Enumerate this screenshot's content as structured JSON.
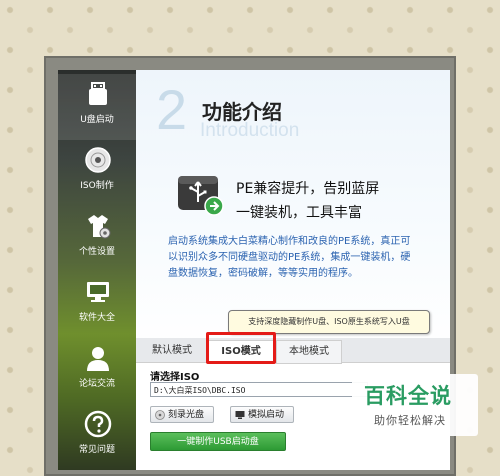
{
  "sidebar": {
    "items": [
      {
        "label": "U盘启动",
        "icon": "usb-drive-icon",
        "active": true
      },
      {
        "label": "ISO制作",
        "icon": "disc-icon",
        "active": false
      },
      {
        "label": "个性设置",
        "icon": "shirt-gear-icon",
        "active": false
      },
      {
        "label": "软件大全",
        "icon": "monitor-icon",
        "active": false
      },
      {
        "label": "论坛交流",
        "icon": "user-icon",
        "active": false
      },
      {
        "label": "常见问题",
        "icon": "help-icon",
        "active": false
      }
    ]
  },
  "intro": {
    "number": "2",
    "title_cn": "功能介绍",
    "title_en": "Introduction",
    "feature_line1": "PE兼容提升，告别蓝屏",
    "feature_line2": "一键装机，工具丰富",
    "description": "启动系统集成大白菜精心制作和改良的PE系统，真正可以识别众多不同硬盘驱动的PE系统，集成一键装机，硬盘数据恢复，密码破解，等等实用的程序。"
  },
  "tooltip": "支持深度隐藏制作U盘、ISO原生系统写入U盘",
  "tabs": [
    {
      "label": "默认模式"
    },
    {
      "label": "ISO模式"
    },
    {
      "label": "本地模式"
    }
  ],
  "iso": {
    "label": "请选择ISO",
    "path": "D:\\大白菜ISO\\DBC.ISO"
  },
  "buttons": {
    "burn": "刻录光盘",
    "simulate": "模拟启动",
    "make": "一键制作USB启动盘"
  },
  "watermark": {
    "line1": "百科全说",
    "line2": "助你轻松解决"
  },
  "colors": {
    "highlight": "#e41b17",
    "description_text": "#2b63b0",
    "make_button": "#2d9a34",
    "watermark_green": "#2a9c62"
  }
}
